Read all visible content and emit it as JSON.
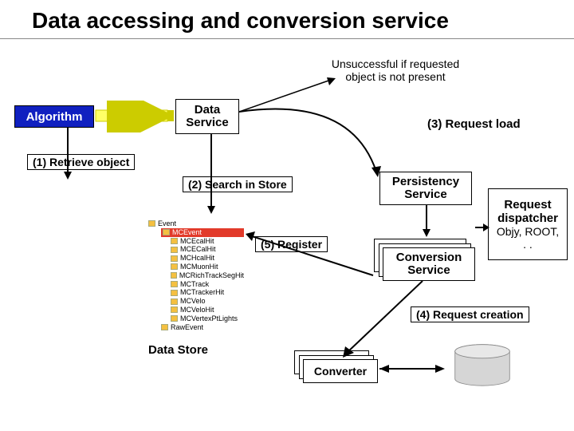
{
  "title": "Data accessing and conversion service",
  "nodes": {
    "algorithm": "Algorithm",
    "data_service": "Data\nService",
    "persistency_service": "Persistency\nService",
    "conversion_service": "Conversion\nService",
    "dispatcher_title": "Request dispatcher",
    "dispatcher_sub": "Objy, ROOT, . .",
    "converter": "Converter"
  },
  "note_unsuccessful": "Unsuccessful if requested object is not present",
  "steps": {
    "s1": "(1) Retrieve object",
    "s2": "(2) Search in Store",
    "s3": "(3) Request load",
    "s4": "(4) Request creation",
    "s5": "(5) Register"
  },
  "data_store_label": "Data Store",
  "tree": {
    "root": "Event",
    "selected": "MCEvent",
    "items": [
      "MCEcalHit",
      "MCECalHit",
      "MCHcalHit",
      "MCMuonHit",
      "MCRichTrackSegHit",
      "MCTrack",
      "MCTrackerHit",
      "MCVelo",
      "MCVeloHit",
      "MCVertexPtLights"
    ],
    "last": "RawEvent"
  },
  "colors": {
    "algorithm_bg": "#1020c0",
    "arrow_yellow": "#ffff66",
    "selected_bg": "#e23a2a"
  }
}
